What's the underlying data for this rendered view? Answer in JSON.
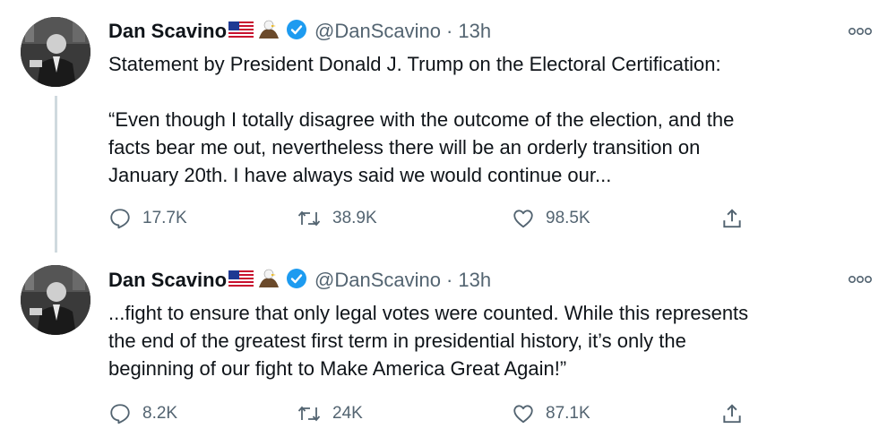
{
  "tweets": [
    {
      "author_name": "Dan Scavino",
      "flag_icon": "us-flag-icon",
      "emoji_icon": "eagle-icon",
      "verified_icon": "verified-badge-icon",
      "handle": "@DanScavino",
      "separator": "·",
      "time": "13h",
      "paragraphs": [
        "Statement by President Donald J. Trump on the Electoral Certification:",
        "“Even though I totally disagree with the outcome of the election, and the\nfacts bear me out, nevertheless there will be an orderly transition on\nJanuary 20th. I have always said we would continue our..."
      ],
      "replies": "17.7K",
      "retweets": "38.9K",
      "likes": "98.5K"
    },
    {
      "author_name": "Dan Scavino",
      "flag_icon": "us-flag-icon",
      "emoji_icon": "eagle-icon",
      "verified_icon": "verified-badge-icon",
      "handle": "@DanScavino",
      "separator": "·",
      "time": "13h",
      "paragraphs": [
        "...fight to ensure that only legal votes were counted. While this represents\nthe end of the greatest first term in presidential history, it’s only the\nbeginning of our fight to Make America Great Again!”"
      ],
      "replies": "8.2K",
      "retweets": "24K",
      "likes": "87.1K"
    }
  ],
  "colors": {
    "text": "#0f1419",
    "secondary": "#536471",
    "verified": "#1d9bf0",
    "thread_line": "#cfd9de"
  }
}
